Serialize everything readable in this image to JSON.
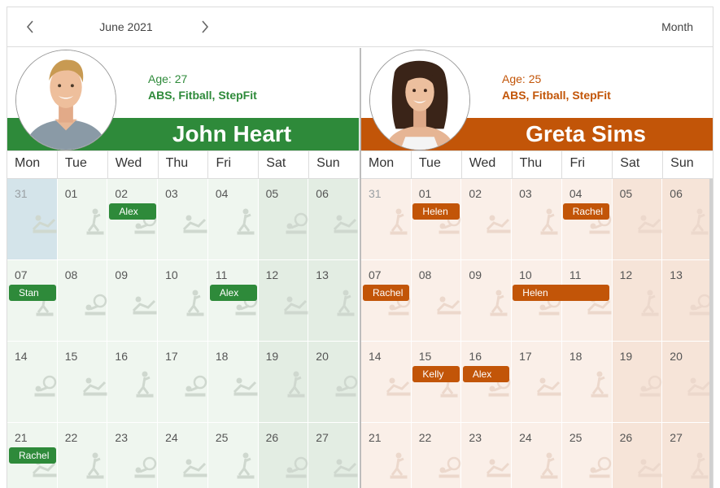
{
  "toolbar": {
    "prev_icon": "chevron-left-icon",
    "next_icon": "chevron-right-icon",
    "period": "June 2021",
    "view": "Month"
  },
  "day_names": [
    "Mon",
    "Tue",
    "Wed",
    "Thu",
    "Fri",
    "Sat",
    "Sun"
  ],
  "colors": {
    "john_accent": "#2e8a3a",
    "greta_accent": "#c25508"
  },
  "trainers": [
    {
      "name": "John Heart",
      "age": "Age: 27",
      "classes": "ABS, Fitball, StepFit",
      "weeks": [
        [
          "31",
          "01",
          "02",
          "03",
          "04",
          "05",
          "06"
        ],
        [
          "07",
          "08",
          "09",
          "10",
          "11",
          "12",
          "13"
        ],
        [
          "14",
          "15",
          "16",
          "17",
          "18",
          "19",
          "20"
        ],
        [
          "21",
          "22",
          "23",
          "24",
          "25",
          "26",
          "27"
        ]
      ],
      "appointments": [
        {
          "text": "Alex",
          "week": 0,
          "day": 2,
          "span": 1
        },
        {
          "text": "Stan",
          "week": 1,
          "day": 0,
          "span": 1
        },
        {
          "text": "Alex",
          "week": 1,
          "day": 4,
          "span": 1
        },
        {
          "text": "Rachel",
          "week": 3,
          "day": 0,
          "span": 1
        }
      ]
    },
    {
      "name": "Greta Sims",
      "age": "Age: 25",
      "classes": "ABS, Fitball, StepFit",
      "weeks": [
        [
          "31",
          "01",
          "02",
          "03",
          "04",
          "05",
          "06"
        ],
        [
          "07",
          "08",
          "09",
          "10",
          "11",
          "12",
          "13"
        ],
        [
          "14",
          "15",
          "16",
          "17",
          "18",
          "19",
          "20"
        ],
        [
          "21",
          "22",
          "23",
          "24",
          "25",
          "26",
          "27"
        ]
      ],
      "appointments": [
        {
          "text": "Helen",
          "week": 0,
          "day": 1,
          "span": 1
        },
        {
          "text": "Rachel",
          "week": 0,
          "day": 4,
          "span": 1
        },
        {
          "text": "Rachel",
          "week": 1,
          "day": 0,
          "span": 1
        },
        {
          "text": "Helen",
          "week": 1,
          "day": 3,
          "span": 2
        },
        {
          "text": "Kelly",
          "week": 2,
          "day": 1,
          "span": 1
        },
        {
          "text": "Alex",
          "week": 2,
          "day": 2,
          "span": 1
        }
      ]
    }
  ]
}
